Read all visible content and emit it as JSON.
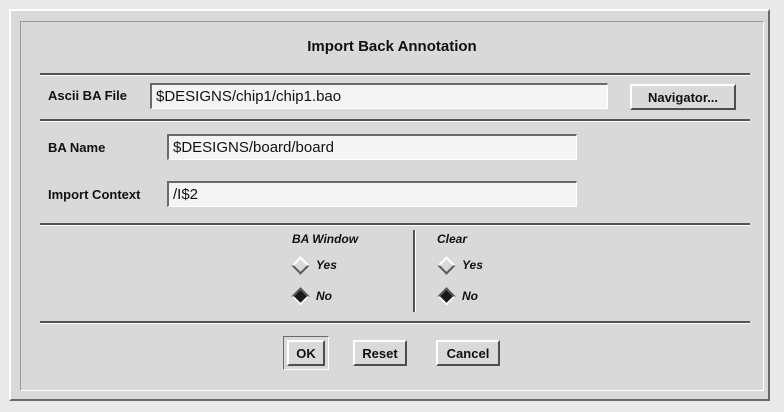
{
  "dialog": {
    "title": "Import Back Annotation"
  },
  "ascii_ba_file": {
    "label": "Ascii BA File",
    "value": "$DESIGNS/chip1/chip1.bao",
    "navigator_label": "Navigator..."
  },
  "ba_name": {
    "label": "BA Name",
    "value": "$DESIGNS/board/board"
  },
  "import_context": {
    "label": "Import Context",
    "value": "/I$2"
  },
  "ba_window": {
    "title": "BA Window",
    "options": [
      {
        "label": "Yes",
        "selected": false
      },
      {
        "label": "No",
        "selected": true
      }
    ]
  },
  "clear": {
    "title": "Clear",
    "options": [
      {
        "label": "Yes",
        "selected": false
      },
      {
        "label": "No",
        "selected": true
      }
    ]
  },
  "buttons": {
    "ok": "OK",
    "reset": "Reset",
    "cancel": "Cancel"
  }
}
